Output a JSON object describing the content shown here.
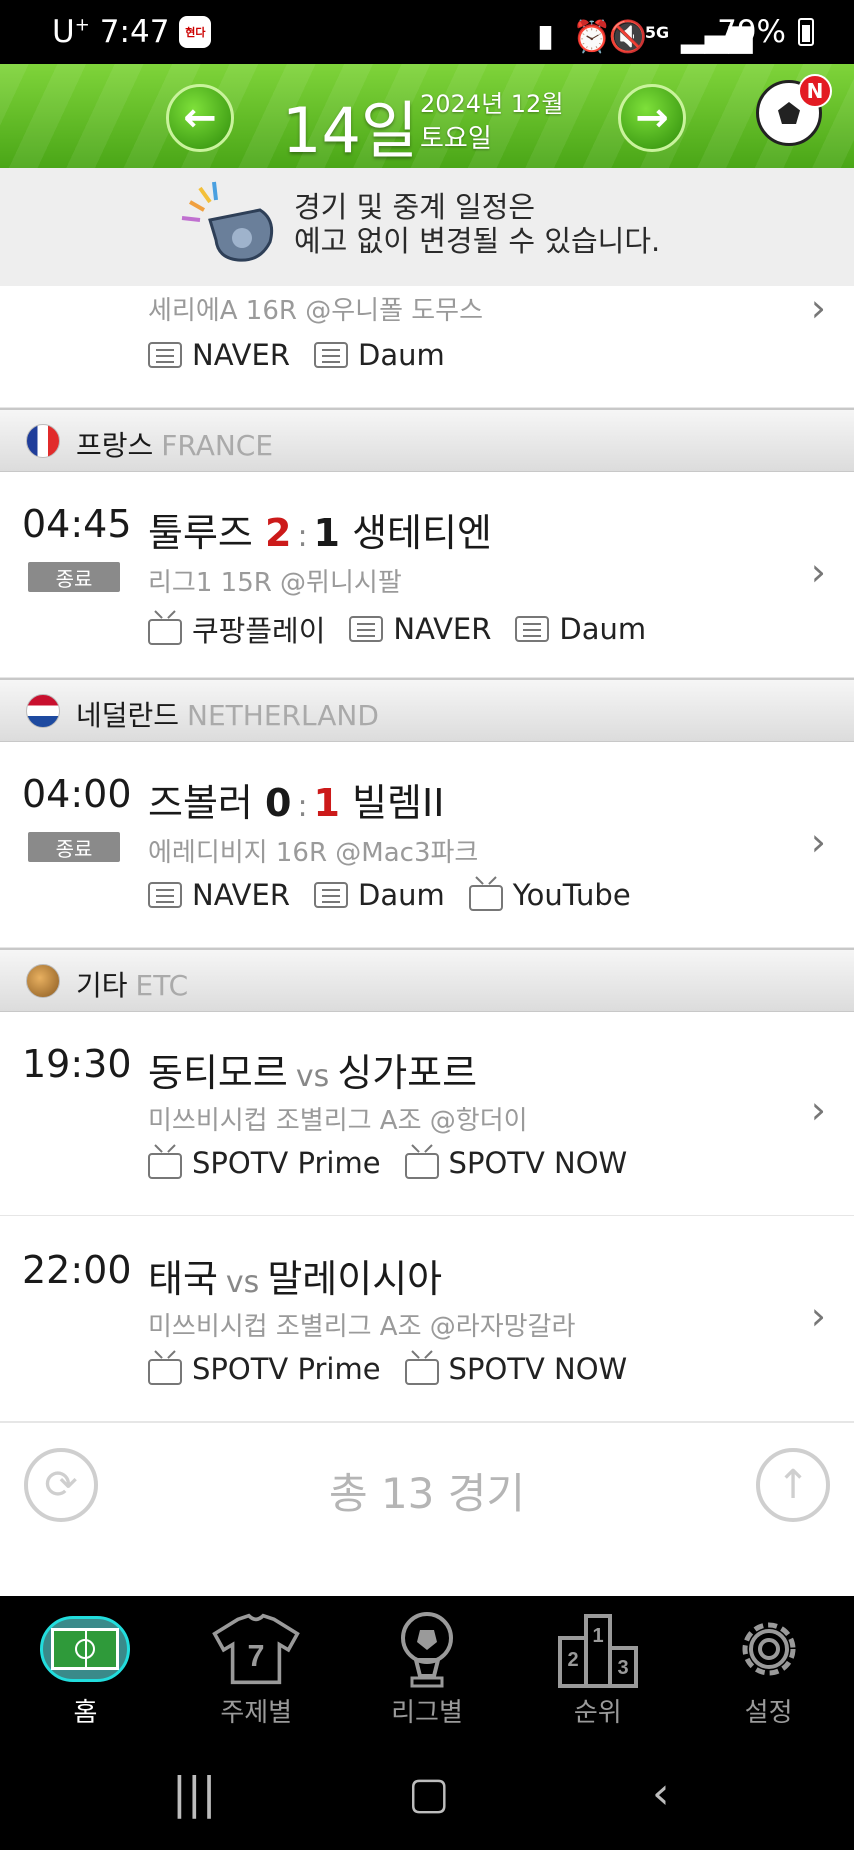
{
  "status_bar": {
    "carrier": "U",
    "carrier_sup": "+",
    "time": "7:47",
    "app_badge": "현다",
    "network": "5G",
    "battery": "79%"
  },
  "header": {
    "day": "14일",
    "year_month": "2024년 12월",
    "weekday": "토요일",
    "notification_badge": "N"
  },
  "notice": {
    "line1": "경기 및 중계 일정은",
    "line2": "예고 없이 변경될 수 있습니다."
  },
  "partial_match": {
    "meta": "세리에A 16R @우니폴 도무스",
    "channels": [
      {
        "type": "text",
        "label": "NAVER"
      },
      {
        "type": "text",
        "label": "Daum"
      }
    ]
  },
  "leagues": [
    {
      "name": "프랑스",
      "name_en": "FRANCE",
      "flag": "france-flag",
      "matches": [
        {
          "time": "04:45",
          "status": "종료",
          "home": "툴루즈",
          "home_score": "2",
          "away_score": "1",
          "away": "생테티엔",
          "meta": "리그1 15R @뮈니시팔",
          "channels": [
            {
              "type": "tv",
              "label": "쿠팡플레이"
            },
            {
              "type": "text",
              "label": "NAVER"
            },
            {
              "type": "text",
              "label": "Daum"
            }
          ]
        }
      ]
    },
    {
      "name": "네덜란드",
      "name_en": "NETHERLAND",
      "flag": "netherlands-flag",
      "matches": [
        {
          "time": "04:00",
          "status": "종료",
          "home": "즈볼러",
          "home_score": "0",
          "away_score": "1",
          "away": "빌렘II",
          "meta": "에레디비지 16R @Mac3파크",
          "channels": [
            {
              "type": "text",
              "label": "NAVER"
            },
            {
              "type": "text",
              "label": "Daum"
            },
            {
              "type": "tv",
              "label": "YouTube"
            }
          ]
        }
      ]
    },
    {
      "name": "기타",
      "name_en": "ETC",
      "flag": "guitar-icon",
      "matches": [
        {
          "time": "19:30",
          "home": "동티모르",
          "vs": "vs",
          "away": "싱가포르",
          "meta": "미쓰비시컵 조별리그 A조 @항더이",
          "channels": [
            {
              "type": "tv",
              "label": "SPOTV Prime"
            },
            {
              "type": "tv",
              "label": "SPOTV NOW"
            }
          ]
        },
        {
          "time": "22:00",
          "home": "태국",
          "vs": "vs",
          "away": "말레이시아",
          "meta": "미쓰비시컵 조별리그 A조 @라자망갈라",
          "channels": [
            {
              "type": "tv",
              "label": "SPOTV Prime"
            },
            {
              "type": "tv",
              "label": "SPOTV NOW"
            }
          ]
        }
      ]
    }
  ],
  "footer": {
    "total": "총 13 경기"
  },
  "bottom_nav": [
    {
      "label": "홈",
      "icon": "soccer-field-icon",
      "active": true
    },
    {
      "label": "주제별",
      "icon": "jersey-7-icon",
      "active": false
    },
    {
      "label": "리그별",
      "icon": "soccer-trophy-icon",
      "active": false
    },
    {
      "label": "순위",
      "icon": "podium-icon",
      "active": false
    },
    {
      "label": "설정",
      "icon": "gear-icon",
      "active": false
    }
  ],
  "colors": {
    "header_green": "#4aa617",
    "score_red": "#cc1a1a",
    "status_gray": "#8a8a8a"
  }
}
